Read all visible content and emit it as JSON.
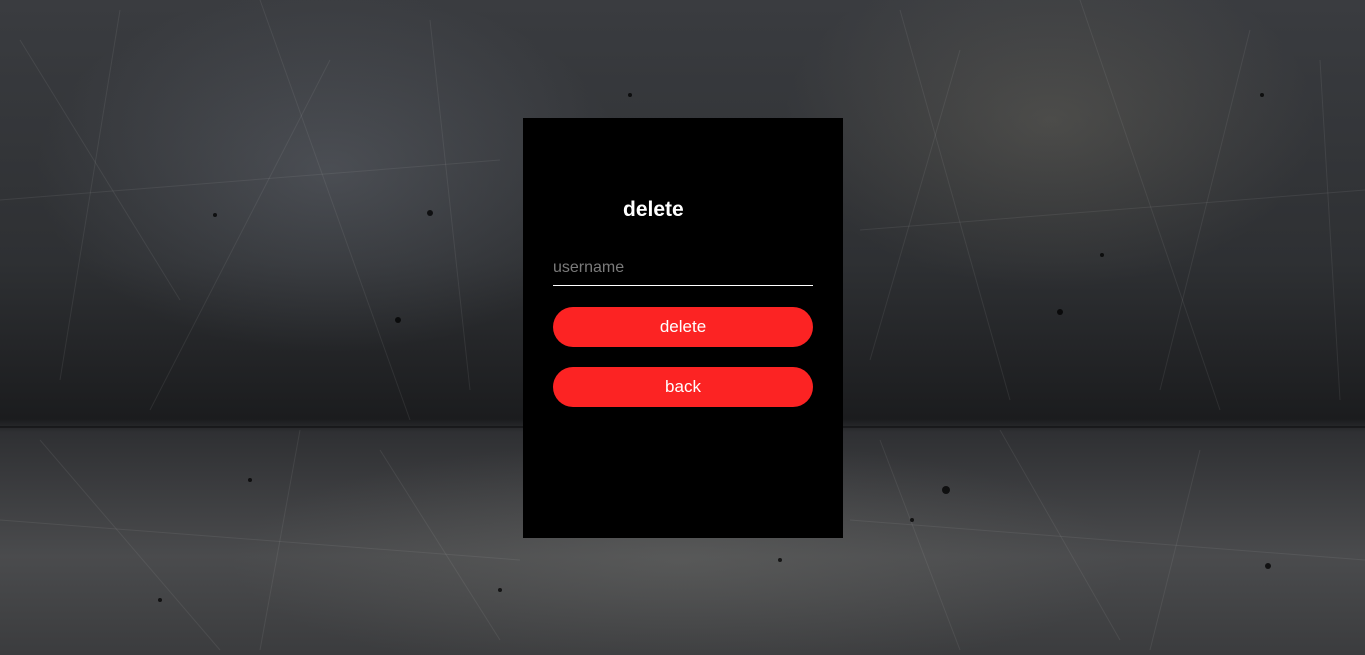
{
  "form": {
    "title": "delete",
    "username_placeholder": "username",
    "username_value": "",
    "delete_label": "delete",
    "back_label": "back"
  },
  "colors": {
    "card_background": "#000000",
    "button_accent": "#fc2323",
    "text": "#ffffff"
  }
}
